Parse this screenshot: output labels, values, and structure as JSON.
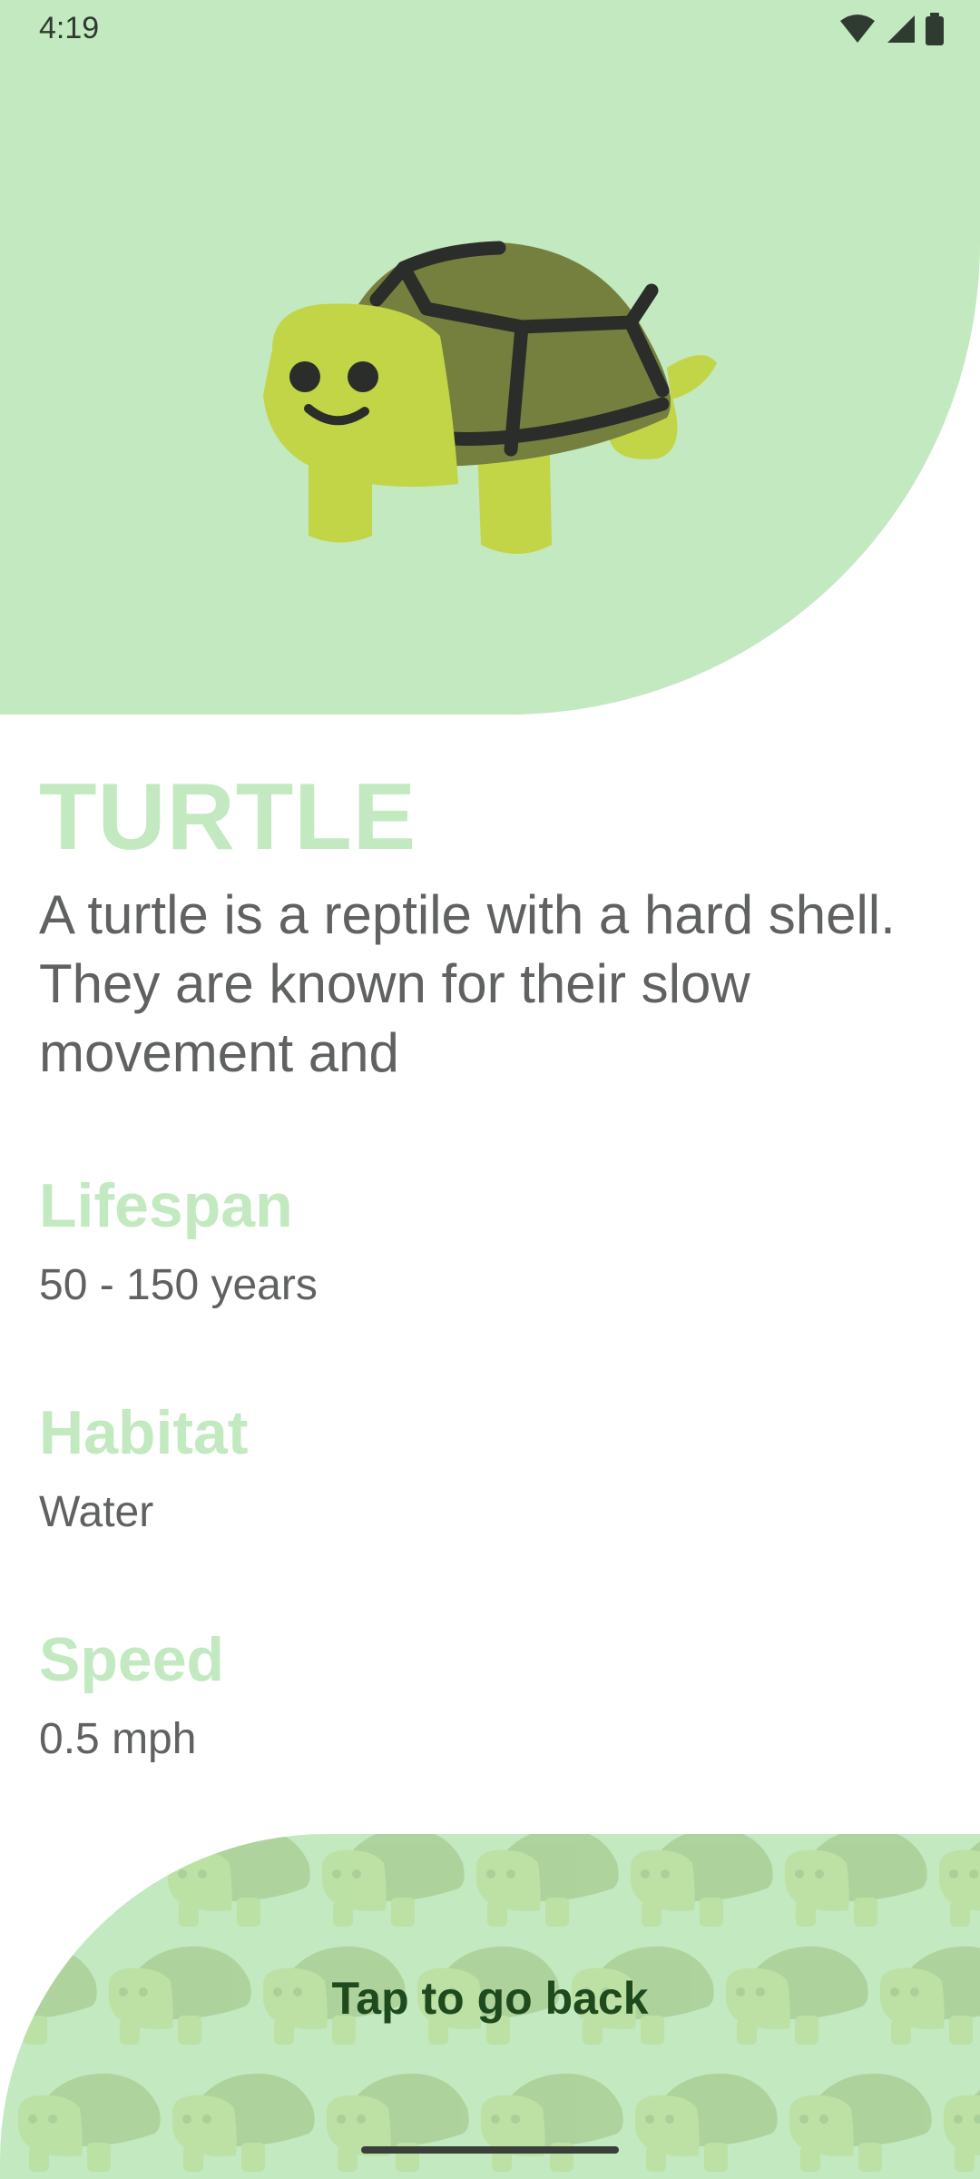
{
  "status_bar": {
    "time": "4:19",
    "icons": [
      "wifi-icon",
      "cellular-signal-icon",
      "battery-icon"
    ]
  },
  "hero": {
    "image": "turtle-emoji",
    "background_color": "#c2e9bf"
  },
  "animal": {
    "name": "TURTLE",
    "description": "A turtle is a reptile with a hard shell. They are known for their slow movement and",
    "sections": [
      {
        "label": "Lifespan",
        "value": "50 - 150 years"
      },
      {
        "label": "Habitat",
        "value": "Water"
      },
      {
        "label": "Speed",
        "value": "0.5 mph"
      }
    ]
  },
  "footer": {
    "back_label": "Tap to go back"
  },
  "colors": {
    "accent": "#c2e9bf",
    "text_muted": "#5f6260",
    "back_text": "#1f4a1e"
  }
}
